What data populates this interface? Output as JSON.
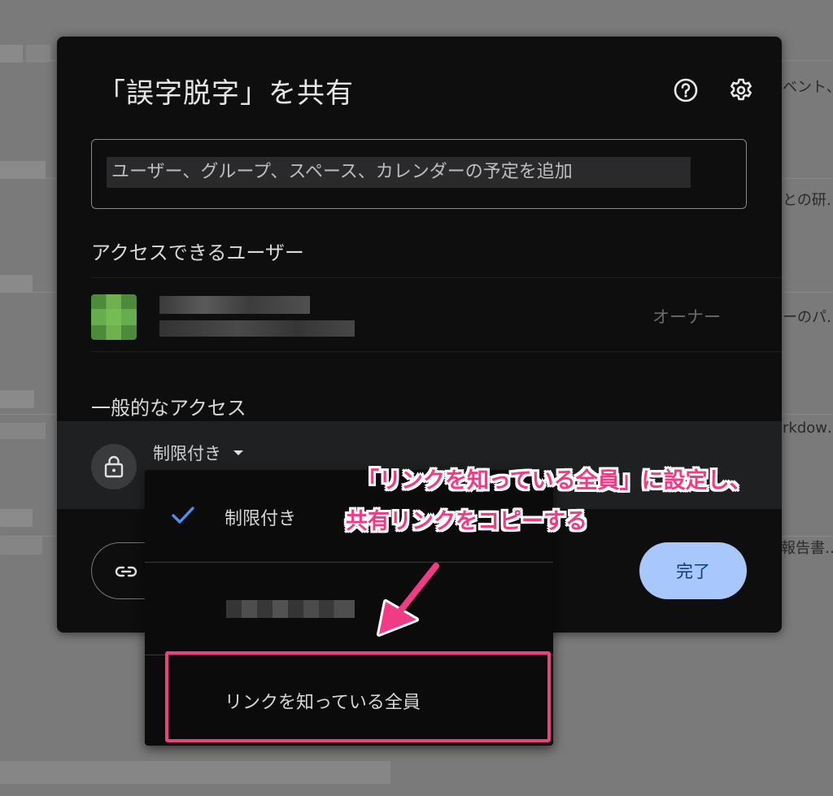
{
  "dialog": {
    "title": "「誤字脱字」を共有",
    "help_icon": "help-circle-icon",
    "settings_icon": "gear-icon",
    "share_input_placeholder": "ユーザー、グループ、スペース、カレンダーの予定を追加",
    "people_with_access_label": "アクセスできるユーザー",
    "owner_role": "オーナー",
    "general_access_label": "一般的なアクセス",
    "access_current": "制限付き",
    "copy_link_icon": "link-icon",
    "done_label": "完了"
  },
  "access_menu": {
    "items": [
      {
        "label": "制限付き",
        "selected": true
      },
      {
        "label": "",
        "selected": false
      },
      {
        "label": "リンクを知っている全員",
        "selected": false
      }
    ]
  },
  "annotation": {
    "line1": "「リンクを知っている全員」に設定し、",
    "line2": "共有リンクをコピーする",
    "color": "#f03c85"
  },
  "background": {
    "snippets": [
      "ベント、",
      "との研…",
      "ーのパ…",
      "rkdow…",
      "報告書…"
    ]
  },
  "colors": {
    "dialog_bg": "#0e0e0f",
    "accent_blue": "#a8c7fa",
    "check_blue": "#4d8ff0",
    "highlight_pink": "#e84283"
  }
}
